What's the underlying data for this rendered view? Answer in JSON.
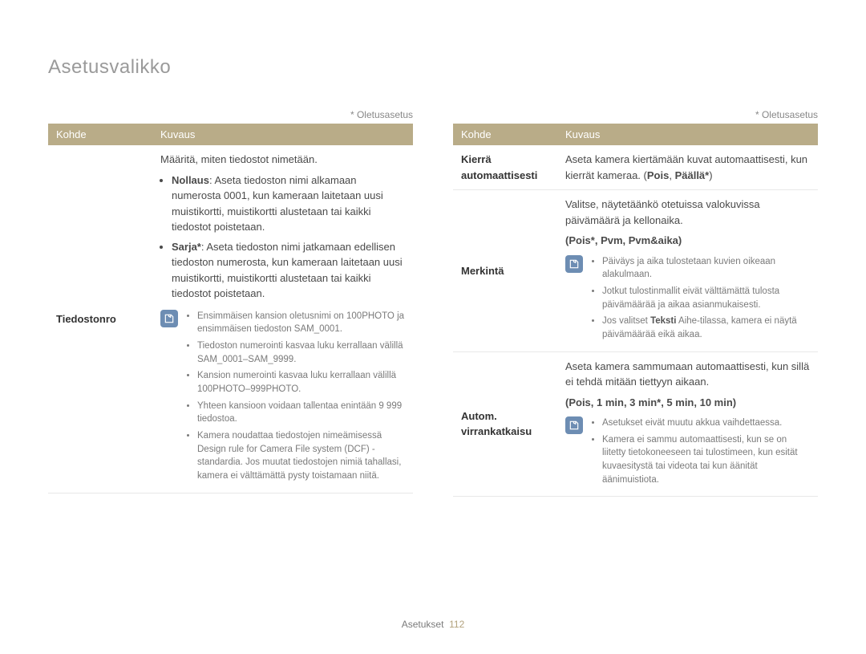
{
  "pageTitle": "Asetusvalikko",
  "defaultNote": "* Oletusasetus",
  "headers": {
    "col1": "Kohde",
    "col2": "Kuvaus"
  },
  "left": {
    "row1": {
      "label": "Tiedostonro",
      "lead": "Määritä, miten tiedostot nimetään.",
      "opt1Name": "Nollaus",
      "opt1Text": ": Aseta tiedoston nimi alkamaan numerosta 0001, kun kameraan laitetaan uusi muistikortti, muistikortti alustetaan tai kaikki tiedostot poistetaan.",
      "opt2Name": "Sarja*",
      "opt2Text": ": Aseta tiedoston nimi jatkamaan edellisen tiedoston numerosta, kun kameraan laitetaan uusi muistikortti, muistikortti alustetaan tai kaikki tiedostot poistetaan.",
      "note1": "Ensimmäisen kansion oletusnimi on 100PHOTO ja ensimmäisen tiedoston SAM_0001.",
      "note2": "Tiedoston numerointi kasvaa luku kerrallaan välillä SAM_0001–SAM_9999.",
      "note3": "Kansion numerointi kasvaa luku kerrallaan välillä 100PHOTO–999PHOTO.",
      "note4": "Yhteen kansioon voidaan tallentaa enintään 9 999 tiedostoa.",
      "note5": "Kamera noudattaa tiedostojen nimeämisessä Design rule for Camera File system (DCF) -standardia. Jos muutat tiedostojen nimiä tahallasi, kamera ei välttämättä pysty toistamaan niitä."
    }
  },
  "right": {
    "row1": {
      "label": "Kierrä automaattisesti",
      "textA": "Aseta kamera kiertämään kuvat automaattisesti, kun kierrät kameraa. (",
      "optA": "Pois",
      "sep": ", ",
      "optB": "Päällä*",
      "textB": ")"
    },
    "row2": {
      "label": "Merkintä",
      "lead": "Valitse, näytetäänkö otetuissa valokuvissa päivämäärä ja kellonaika.",
      "options": "(Pois*, Pvm, Pvm&aika)",
      "note1": "Päiväys ja aika tulostetaan kuvien oikeaan alakulmaan.",
      "note2": "Jotkut tulostinmallit eivät välttämättä tulosta päivämäärää ja aikaa asianmukaisesti.",
      "note3a": "Jos valitset ",
      "note3b": "Teksti",
      "note3c": " Aihe-tilassa, kamera ei näytä päivämäärää eikä aikaa."
    },
    "row3": {
      "label": "Autom. virrankatkaisu",
      "lead": "Aseta kamera sammumaan automaattisesti, kun sillä ei tehdä mitään tiettyyn aikaan.",
      "options": "(Pois, 1 min, 3 min*, 5 min, 10 min)",
      "note1": "Asetukset eivät muutu akkua vaihdettaessa.",
      "note2": "Kamera ei sammu automaattisesti, kun se on liitetty tietokoneeseen tai tulostimeen, kun esität kuvaesitystä tai videota tai kun äänität äänimuistiota."
    }
  },
  "footer": {
    "section": "Asetukset",
    "page": "112"
  }
}
